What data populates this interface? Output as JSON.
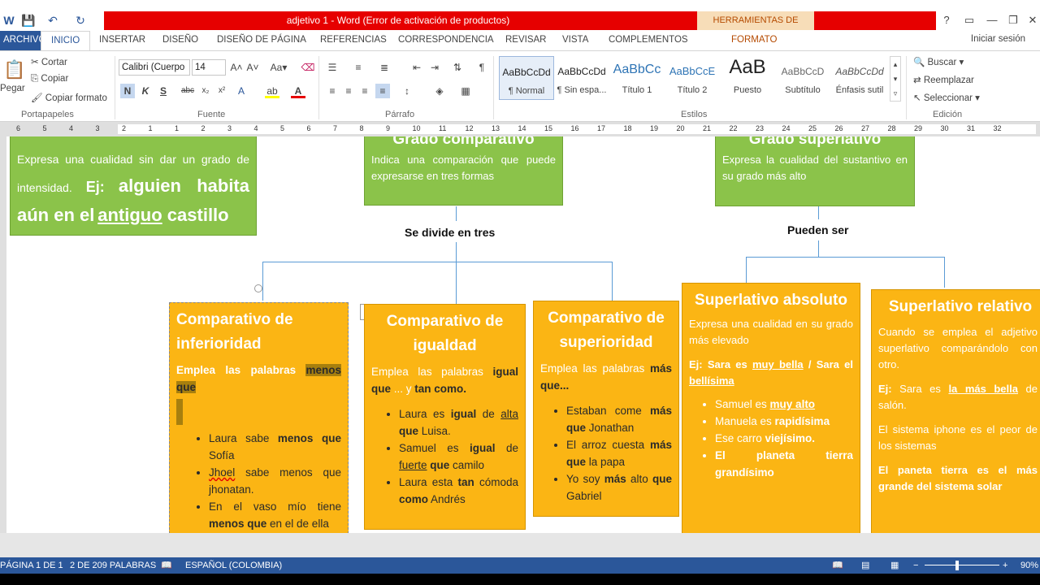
{
  "window": {
    "title": "adjetivo 1 -  Word (Error de activación de productos)",
    "contextual_tab": "HERRAMIENTAS DE DIBUJO",
    "help": "?",
    "min": "—",
    "restore": "❐",
    "close": "✕"
  },
  "tabs": [
    "ARCHIVO",
    "INICIO",
    "INSERTAR",
    "DISEÑO",
    "DISEÑO DE PÁGINA",
    "REFERENCIAS",
    "CORRESPONDENCIA",
    "REVISAR",
    "VISTA",
    "COMPLEMENTOS",
    "FORMATO"
  ],
  "signin": "Iniciar sesión",
  "clipboard": {
    "paste": "Pegar",
    "cut": "Cortar",
    "copy": "Copiar",
    "format_painter": "Copiar formato",
    "label": "Portapapeles"
  },
  "font": {
    "name": "Calibri (Cuerpo",
    "size": "14",
    "label": "Fuente",
    "bold": "N",
    "italic": "K",
    "underline": "S"
  },
  "paragraph": {
    "label": "Párrafo"
  },
  "styles": {
    "label": "Estilos",
    "items": [
      {
        "sample": "AaBbCcDd",
        "name": "¶ Normal"
      },
      {
        "sample": "AaBbCcDd",
        "name": "¶ Sin espa..."
      },
      {
        "sample": "AaBbCc",
        "name": "Título 1"
      },
      {
        "sample": "AaBbCcE",
        "name": "Título 2"
      },
      {
        "sample": "AaB",
        "name": "Puesto"
      },
      {
        "sample": "AaBbCcD",
        "name": "Subtítulo"
      },
      {
        "sample": "AaBbCcDd",
        "name": "Énfasis sutil"
      }
    ]
  },
  "editing": {
    "find": "Buscar",
    "replace": "Reemplazar",
    "select": "Seleccionar",
    "label": "Edición"
  },
  "ruler_ticks": [
    "6",
    "5",
    "4",
    "3",
    "2",
    "1",
    "1",
    "2",
    "3",
    "4",
    "5",
    "6",
    "7",
    "8",
    "9",
    "10",
    "11",
    "12",
    "13",
    "14",
    "15",
    "16",
    "17",
    "18",
    "19",
    "20",
    "21",
    "22",
    "23",
    "24",
    "25",
    "26",
    "27",
    "28",
    "29",
    "30",
    "31",
    "32"
  ],
  "diagram": {
    "positivo": {
      "desc1": "Expresa una cualidad sin dar un grado de intensidad.",
      "ej": "Ej:",
      "ex_a": "alguien habita aún en el",
      "ex_u": "antiguo",
      "ex_b": " castillo"
    },
    "comparativo": {
      "title": "Grado comparativo",
      "desc": "Indica una comparación que puede expresarse en tres formas"
    },
    "superlativo": {
      "title": "Grado superlativo",
      "desc": "Expresa la cualidad del sustantivo en su grado más alto"
    },
    "label_divide": "Se divide en tres",
    "label_pueden": "Pueden ser",
    "inferioridad": {
      "title": "Comparativo de inferioridad",
      "lead": "Emplea las palabras",
      "kw": "menos que",
      "items": [
        {
          "a": "Laura sabe ",
          "b": "menos que",
          "c": " Sofía"
        },
        {
          "a": "Jhoel",
          "b": "",
          "c": " sabe menos que jhonatan."
        },
        {
          "a": "En el vaso mío tiene ",
          "b": "menos que",
          "c": " en el de ella"
        }
      ]
    },
    "igualdad": {
      "title": "Comparativo de igualdad",
      "lead": "Emplea las palabras",
      "kw1": "igual que",
      "mid": " ... y ",
      "kw2": "tan como.",
      "items": [
        {
          "a": "Laura es ",
          "b": "igual",
          "c": " de ",
          "d": "alta",
          "e": " que",
          "f": " Luisa."
        },
        {
          "a": "Samuel es ",
          "b": "igual",
          "c": " de ",
          "d": "fuerte",
          "e": " que",
          "f": " camilo"
        },
        {
          "a": "Laura esta ",
          "b": "tan",
          "c": " cómoda ",
          "d": "",
          "e": "como",
          "f": " Andrés"
        }
      ]
    },
    "superioridad": {
      "title": "Comparativo de superioridad",
      "lead": "Emplea las palabras",
      "kw": "más que...",
      "items": [
        {
          "a": "Estaban come ",
          "b": "más que",
          "c": " Jonathan"
        },
        {
          "a": "El arroz cuesta ",
          "b": "más que",
          "c": " la papa"
        },
        {
          "a": "Yo soy ",
          "b": "más",
          "c": " alto ",
          "d": "que",
          "e": " Gabriel"
        }
      ]
    },
    "absoluto": {
      "title": "Superlativo absoluto",
      "desc": "Expresa una cualidad en su grado más elevado",
      "ej_a": "Ej: Sara es ",
      "ej_b": "muy bella",
      "ej_c": " / Sara el ",
      "ej_d": "bellísima",
      "items": [
        {
          "a": "Samuel es ",
          "b": "muy alto"
        },
        {
          "a": "Manuela es ",
          "b": "rapidísima"
        },
        {
          "a": "Ese carro ",
          "b": "viejísimo."
        },
        {
          "a": "",
          "b": "El planeta tierra grandísimo"
        }
      ]
    },
    "relativo": {
      "title": "Superlativo relativo",
      "desc": "Cuando se emplea el adjetivo superlativo comparándolo con otro.",
      "ej_a": "Ej:",
      "ej_b": " Sara es ",
      "ej_c": "la más bella",
      "ej_d": " de salón.",
      "p2": "El sistema iphone es el peor de los sistemas",
      "p3": "El paneta tierra es el más grande del sistema solar"
    }
  },
  "status": {
    "page": "PÁGINA 1 DE 1",
    "words": "2 DE 209 PALABRAS",
    "lang": "ESPAÑOL (COLOMBIA)",
    "zoom": "90%"
  }
}
